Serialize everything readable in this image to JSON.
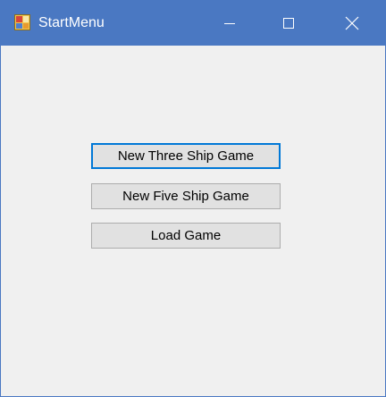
{
  "window": {
    "title": "StartMenu",
    "titlebar_color": "#4a78c2",
    "background_color": "#f0f0f0",
    "app_icon": "app-icon",
    "controls": {
      "minimize_icon": "minimize-icon",
      "maximize_icon": "maximize-icon",
      "close_icon": "close-icon"
    }
  },
  "buttons": {
    "new_three_ship": "New Three Ship Game",
    "new_five_ship": "New Five Ship Game",
    "load_game": "Load Game",
    "focused_button": "new_three_ship",
    "focus_color": "#0078d7"
  }
}
